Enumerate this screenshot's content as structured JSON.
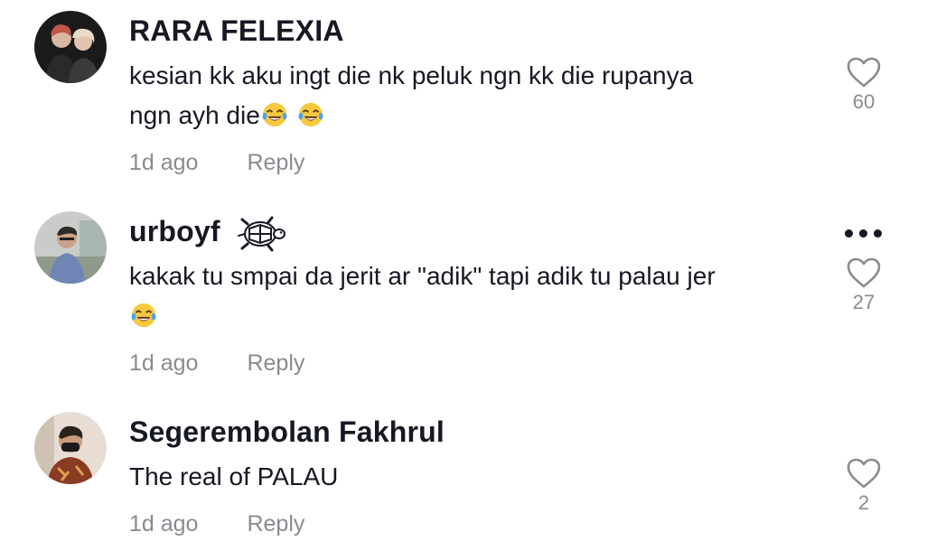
{
  "comments": [
    {
      "username": "RARA FELEXIA",
      "text_line1": "kesian kk aku ingt die nk peluk ngn kk die rupanya",
      "text_line2": "ngn ayh die",
      "time": "1d ago",
      "reply": "Reply",
      "likes": "60",
      "avatar": "avatar-two-people-icon",
      "emoji_count": 2
    },
    {
      "username": "urboyf",
      "badge_icon": "turtle-icon",
      "text_line1": "kakak tu smpai da jerit ar \"adik\" tapi adik tu palau jer",
      "time": "1d ago",
      "reply": "Reply",
      "likes": "27",
      "avatar": "avatar-person-icon",
      "more_icon": "more-options-icon",
      "emoji_count": 1
    },
    {
      "username": "Segerembolan Fakhrul",
      "text_line1": "The real of PALAU",
      "time": "1d ago",
      "reply": "Reply",
      "likes": "2",
      "avatar": "avatar-person-mask-icon"
    }
  ],
  "colors": {
    "text": "#161823",
    "meta": "#8a8b91",
    "background": "#ffffff"
  },
  "emoji": "face-with-tears-of-joy-icon"
}
